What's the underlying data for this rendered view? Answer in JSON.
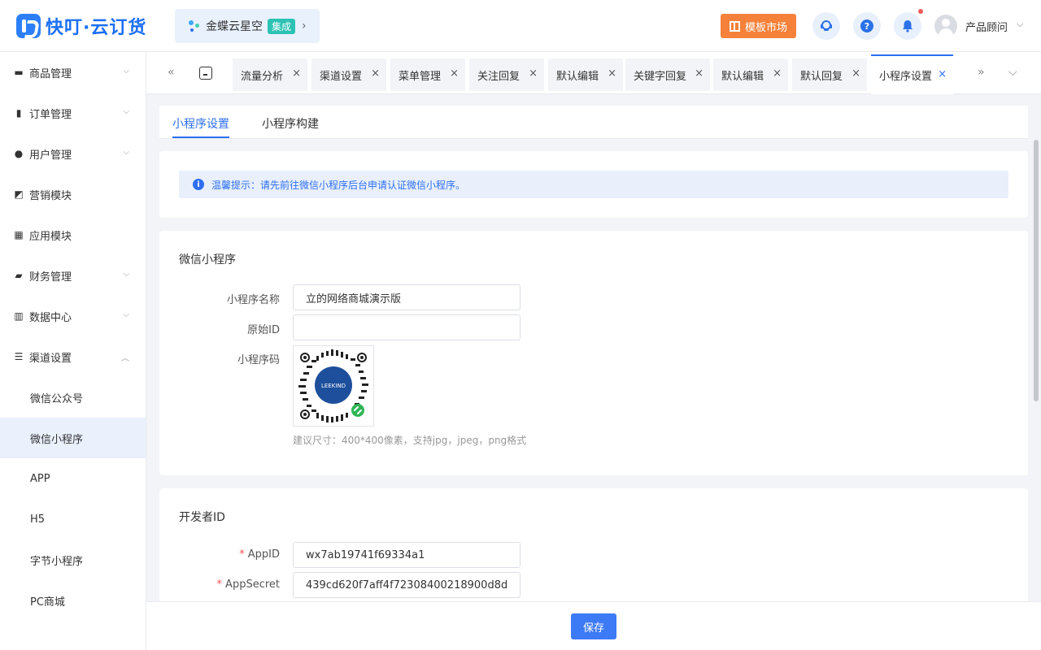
{
  "header": {
    "logo_text": "快叮·云订货",
    "brand_name": "金蝶云星空",
    "brand_badge": "集成",
    "template_market": "模板市场",
    "user_name": "产品顾问"
  },
  "sidebar": {
    "items": [
      {
        "label": "商品管理",
        "icon": "box-icon"
      },
      {
        "label": "订单管理",
        "icon": "clipboard-icon"
      },
      {
        "label": "用户管理",
        "icon": "user-icon"
      },
      {
        "label": "营销模块",
        "icon": "trend-icon"
      },
      {
        "label": "应用模块",
        "icon": "grid-icon"
      },
      {
        "label": "财务管理",
        "icon": "wallet-icon"
      },
      {
        "label": "数据中心",
        "icon": "bar-chart-icon"
      },
      {
        "label": "渠道设置",
        "icon": "list-icon"
      }
    ],
    "sub_items": [
      "微信公众号",
      "微信小程序",
      "APP",
      "H5",
      "字节小程序",
      "PC商城"
    ]
  },
  "tabs": [
    "流量分析",
    "渠道设置",
    "菜单管理",
    "关注回复",
    "默认编辑",
    "关键字回复",
    "默认编辑",
    "默认回复",
    "小程序设置"
  ],
  "subtabs": [
    "小程序设置",
    "小程序构建"
  ],
  "notice": "温馨提示：请先前往微信小程序后台申请认证微信小程序。",
  "mini_program": {
    "section_title": "微信小程序",
    "name_label": "小程序名称",
    "name_value": "立的网络商城演示版",
    "origin_label": "原始ID",
    "origin_value": "",
    "code_label": "小程序码",
    "qr_logo_text": "LEEKIND",
    "hint": "建议尺寸：400*400像素，支持jpg，jpeg，png格式"
  },
  "developer": {
    "section_title": "开发者ID",
    "appid_label": "AppID",
    "appid_value": "wx7ab19741f69334a1",
    "secret_label": "AppSecret",
    "secret_value": "439cd620f7aff4f72308400218900d8d"
  },
  "footer": {
    "save_label": "保存"
  },
  "colors": {
    "accent": "#2d6ff0",
    "orange": "#f5813a",
    "teal": "#2cc2b4"
  }
}
